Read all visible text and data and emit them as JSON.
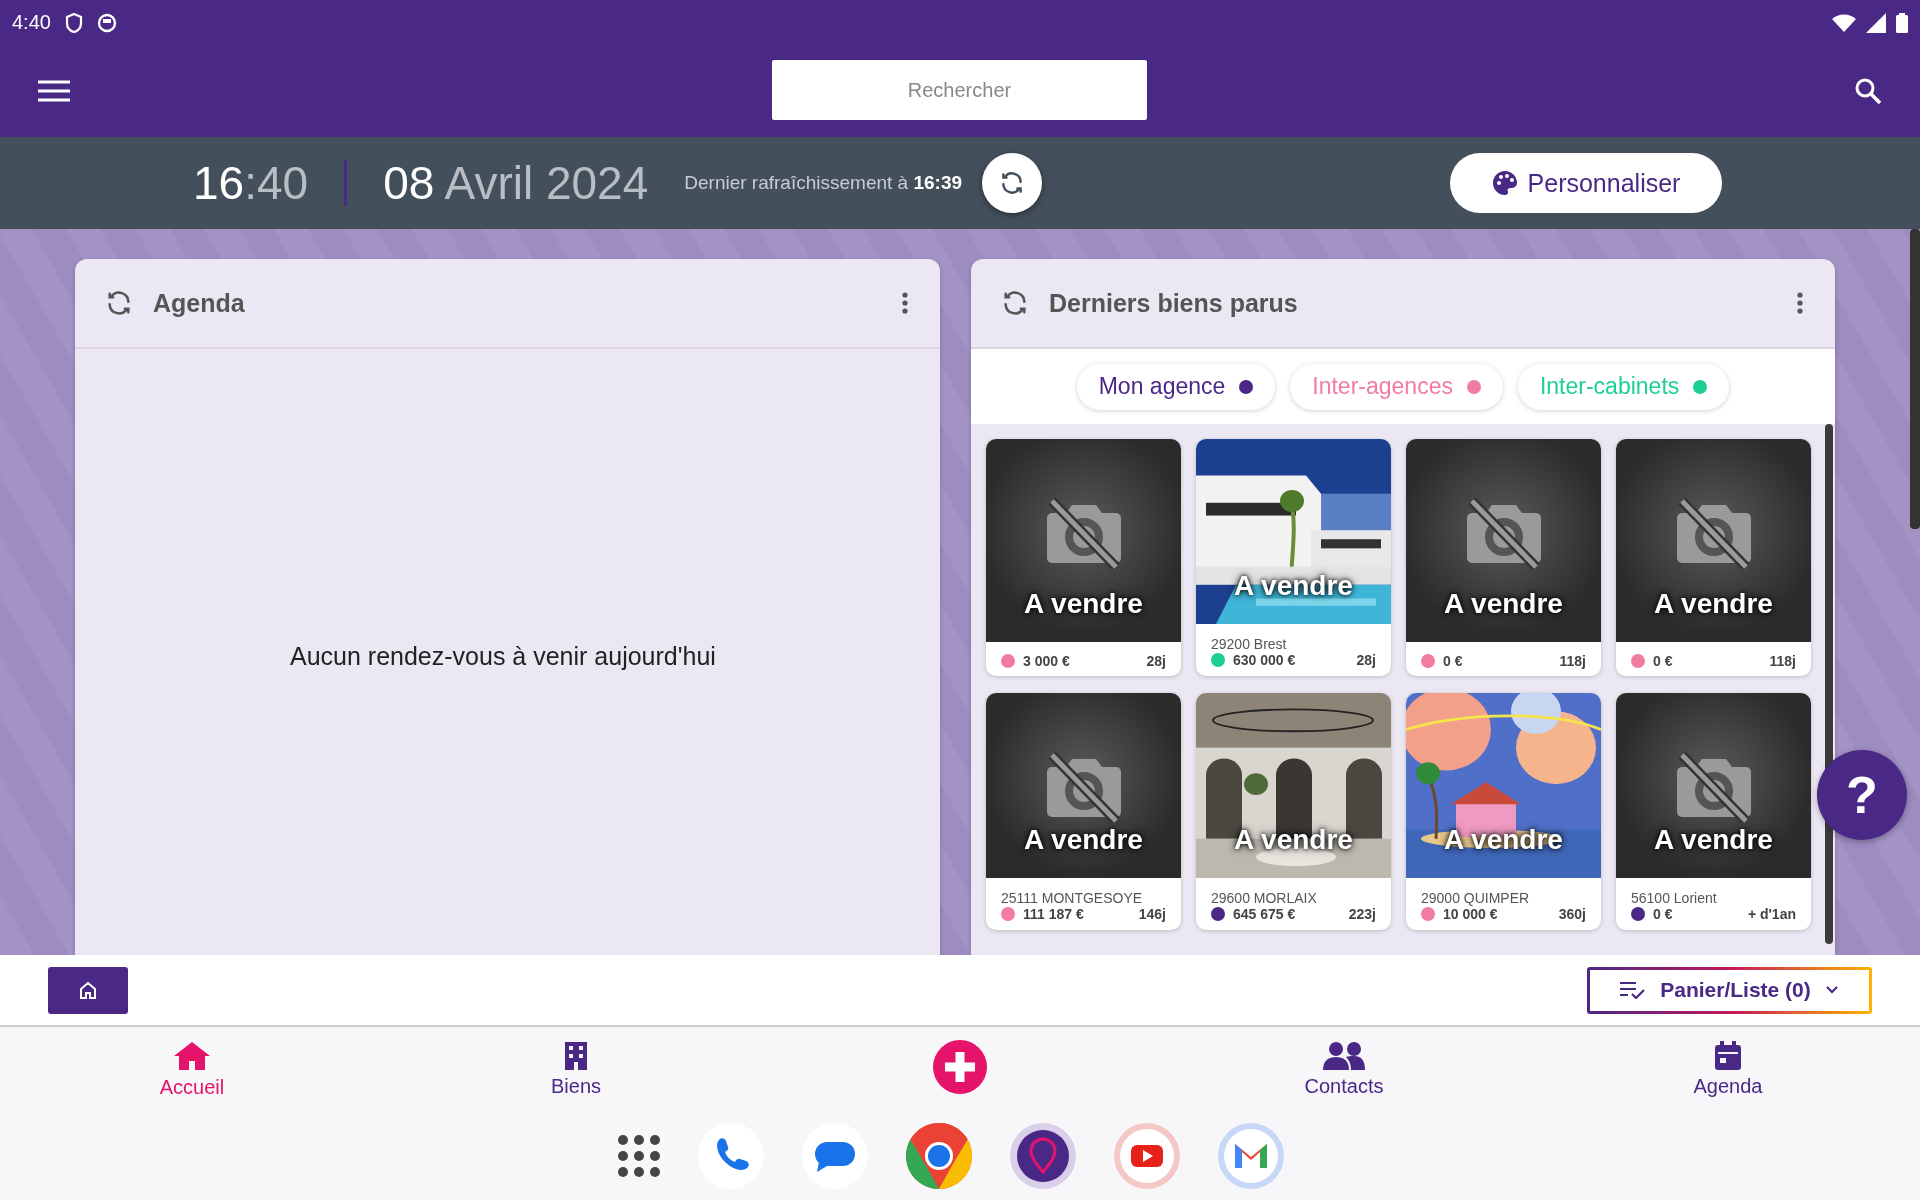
{
  "status_bar": {
    "time": "4:40"
  },
  "app_bar": {
    "search": {
      "placeholder": "Rechercher"
    }
  },
  "info_bar": {
    "time_hours": "16",
    "time_rest": ":40",
    "date_day": "08",
    "date_rest": "Avril 2024",
    "refresh_text": "Dernier rafraîchissement à **16:39**",
    "customize_button": "Personnaliser"
  },
  "agenda": {
    "title": "Agenda",
    "empty_message": "Aucun rendez-vous à venir aujourd'hui"
  },
  "help_button": "?",
  "listings": {
    "title": "Derniers biens parus",
    "filters": [
      {
        "label": "Mon agence",
        "color": "#4a2886"
      },
      {
        "label": "Inter-agences",
        "color": "#f27ba0"
      },
      {
        "label": "Inter-cabinets",
        "color": "#1dd091"
      }
    ],
    "tiles": [
      {
        "kind": "no_photo",
        "status": "A vendre",
        "color": "#f27ba0",
        "price": "3 000 €",
        "age": "28j"
      },
      {
        "status": "A vendre",
        "location": "29200 Brest",
        "color": "#1dd091",
        "price": "630 000 €",
        "age": "28j"
      },
      {
        "kind": "no_photo",
        "status": "A vendre",
        "color": "#f27ba0",
        "price": "0 €",
        "age": "118j"
      },
      {
        "kind": "no_photo",
        "status": "A vendre",
        "color": "#f27ba0",
        "price": "0 €",
        "age": "118j"
      },
      {
        "kind": "no_photo",
        "status": "A vendre",
        "location": "25111 MONTGESOYE",
        "color": "#f27ba0",
        "price": "111 187 €",
        "age": "146j"
      },
      {
        "status": "A vendre",
        "location": "29600 MORLAIX",
        "color": "#4a2886",
        "price": "645 675 €",
        "age": "223j"
      },
      {
        "status": "A vendre",
        "location": "29000 QUIMPER",
        "color": "#f27ba0",
        "price": "10 000 €",
        "age": "360j"
      },
      {
        "kind": "no_photo",
        "status": "A vendre",
        "location": "56100 Lorient",
        "color": "#4a2886",
        "price": "0 €",
        "age": "+ d'1an"
      }
    ]
  },
  "bottom_bar": {
    "basket_button": "Panier/Liste (0)"
  },
  "nav": [
    {
      "kind": "home",
      "label": "Accueil",
      "selected": true
    },
    {
      "kind": "building",
      "label": "Biens",
      "selected": false
    },
    {
      "kind": "add",
      "selected": false
    },
    {
      "kind": "people",
      "label": "Contacts",
      "selected": false
    },
    {
      "kind": "calendar",
      "label": "Agenda",
      "selected": false
    }
  ]
}
